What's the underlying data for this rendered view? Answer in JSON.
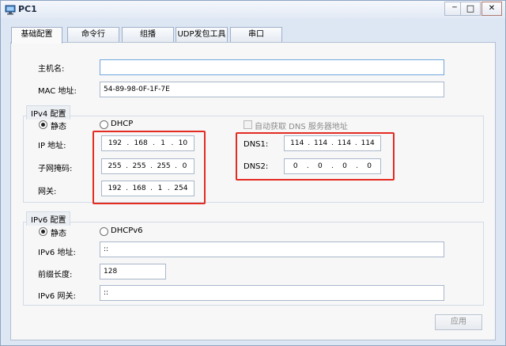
{
  "window": {
    "title": "PC1",
    "minimize": "─",
    "maximize": "□",
    "close": "✕"
  },
  "tabs": [
    {
      "label": "基础配置"
    },
    {
      "label": "命令行"
    },
    {
      "label": "组播"
    },
    {
      "label": "UDP发包工具"
    },
    {
      "label": "串口"
    }
  ],
  "basic": {
    "hostname_label": "主机名:",
    "hostname_value": "",
    "mac_label": "MAC 地址:",
    "mac_value": "54-89-98-0F-1F-7E"
  },
  "ipv4": {
    "legend": "IPv4 配置",
    "static_label": "静态",
    "dhcp_label": "DHCP",
    "auto_dns_label": "自动获取 DNS 服务器地址",
    "ip_label": "IP 地址:",
    "ip": [
      "192",
      "168",
      "1",
      "10"
    ],
    "mask_label": "子网掩码:",
    "mask": [
      "255",
      "255",
      "255",
      "0"
    ],
    "gateway_label": "网关:",
    "gateway": [
      "192",
      "168",
      "1",
      "254"
    ],
    "dns1_label": "DNS1:",
    "dns1": [
      "114",
      "114",
      "114",
      "114"
    ],
    "dns2_label": "DNS2:",
    "dns2": [
      "0",
      "0",
      "0",
      "0"
    ],
    "dot": "."
  },
  "ipv6": {
    "legend": "IPv6 配置",
    "static_label": "静态",
    "dhcp_label": "DHCPv6",
    "addr_label": "IPv6 地址:",
    "addr_value": "::",
    "prefix_label": "前缀长度:",
    "prefix_value": "128",
    "gateway_label": "IPv6 网关:",
    "gateway_value": "::"
  },
  "apply_label": "应用",
  "colors": {
    "highlight": "#e32b22",
    "title_bar": "#e3eaf5",
    "focus_border": "#6fa6de"
  }
}
